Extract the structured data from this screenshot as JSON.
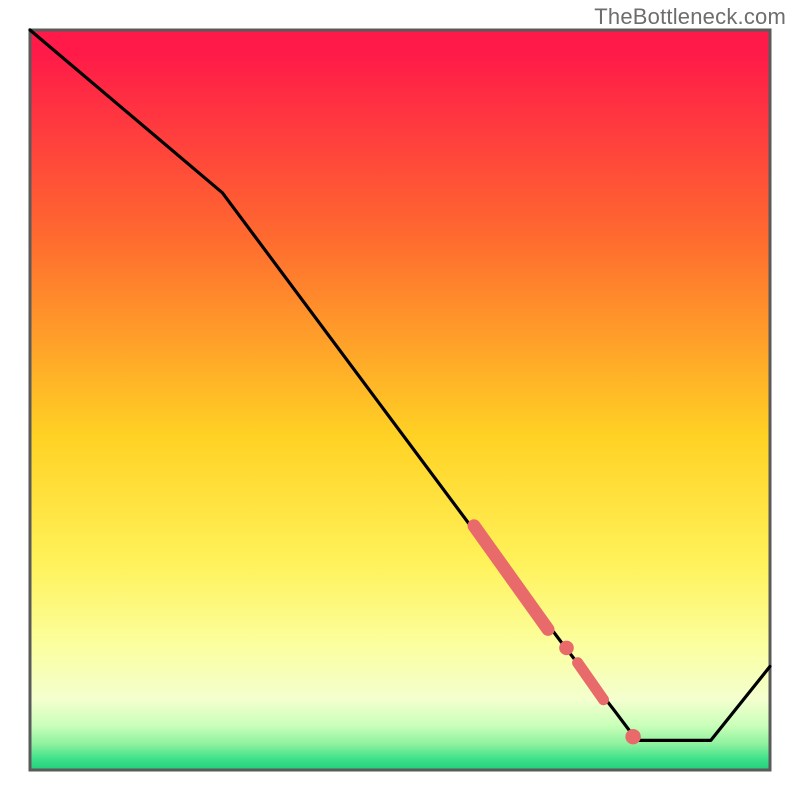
{
  "watermark": {
    "label": "TheBottleneck.com"
  },
  "colors": {
    "gradient_top": "#ff1a49",
    "gradient_mid1": "#ff8a2a",
    "gradient_mid2": "#ffe52a",
    "gradient_mid3": "#f8ff8a",
    "gradient_low": "#c9ffb9",
    "gradient_bottom": "#23d67e",
    "frame": "#5a5a5a",
    "line": "#000000",
    "marker": "#e86a6a"
  },
  "chart_data": {
    "type": "line",
    "title": "",
    "xlabel": "",
    "ylabel": "",
    "xlim": [
      0,
      100
    ],
    "ylim": [
      0,
      100
    ],
    "grid": false,
    "series": [
      {
        "name": "curve",
        "x": [
          0,
          26,
          64,
          69,
          72,
          79,
          82,
          92,
          100
        ],
        "y": [
          100,
          78,
          27,
          21,
          17,
          8,
          4,
          4,
          14
        ]
      }
    ],
    "markers": [
      {
        "shape": "capsule",
        "x_start": 60,
        "y_start": 33,
        "x_end": 70,
        "y_end": 19,
        "width": 1.6
      },
      {
        "shape": "dot",
        "x": 72.5,
        "y": 16.5,
        "r": 0.9
      },
      {
        "shape": "capsule",
        "x_start": 74,
        "y_start": 14.5,
        "x_end": 77.5,
        "y_end": 9.5,
        "width": 1.4
      },
      {
        "shape": "dot",
        "x": 81.5,
        "y": 4.5,
        "r": 1.0
      }
    ]
  }
}
